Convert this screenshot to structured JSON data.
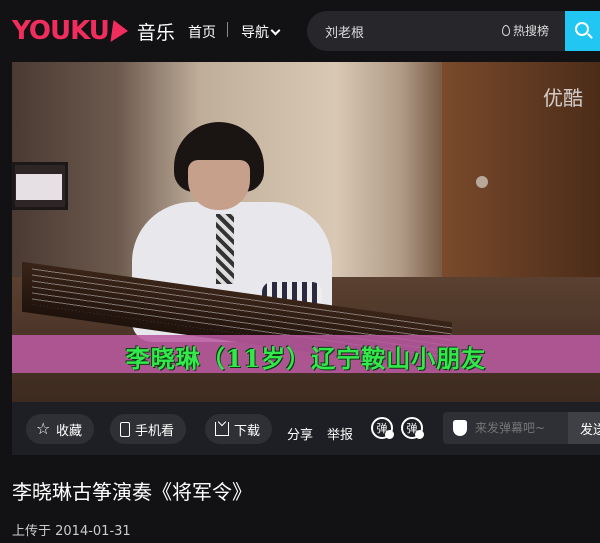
{
  "header": {
    "logo_text": "YOUKU",
    "logo_section": "音乐",
    "nav_home": "首页",
    "nav_guide": "导航",
    "search_value": "刘老根",
    "hot_list_label": "热搜榜",
    "colors": {
      "brand_pink": "#f02d5c",
      "search_button": "#21c7f2"
    }
  },
  "player": {
    "watermark": "优酷",
    "subtitle": "李晓琳（11岁）辽宁鞍山小朋友"
  },
  "controls": {
    "favorite_label": "收藏",
    "mobile_label": "手机看",
    "download_label": "下载",
    "share_label": "分享",
    "report_label": "举报",
    "danmu_icon_1": "弹",
    "danmu_icon_2": "弹",
    "danmu_placeholder": "来发弹幕吧~",
    "send_label": "发送"
  },
  "video": {
    "title": "李晓琳古筝演奏《将军令》",
    "upload_date": "上传于 2014-01-31"
  }
}
